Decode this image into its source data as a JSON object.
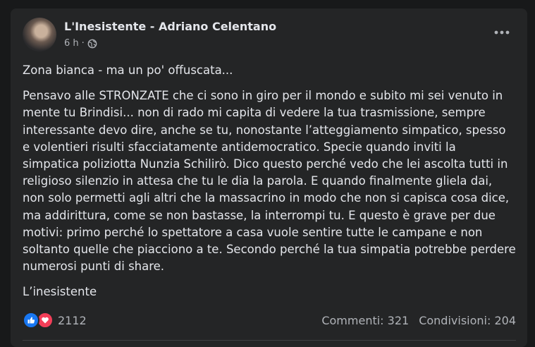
{
  "post": {
    "author": "L'Inesistente - Adriano Celentano",
    "time": "6 h",
    "separator": "·",
    "title": "Zona bianca - ma un po' offuscata...",
    "body": "Pensavo alle STRONZATE che ci sono in giro per il mondo e subito mi sei venuto in mente tu Brindisi... non di rado mi capita di vedere la tua trasmissione, sempre interessante devo dire, anche se tu, nonostante l’atteggiamento simpatico, spesso e volentieri risulti sfacciatamente antidemocratico. Specie quando inviti la simpatica poliziotta Nunzia Schilirò. Dico questo perché vedo che lei ascolta tutti in religioso silenzio in attesa che tu le dia la parola. E quando finalmente gliela dai, non solo permetti agli altri che la massacrino in modo che non si capisca cosa dice, ma addirittura, come se non bastasse, la interrompi tu. E questo è grave per due motivi: primo perché lo spettatore a casa vuole sentire tutte le campane e non soltanto quelle che piacciono a te. Secondo perché la tua simpatia potrebbe perdere numerosi punti di share.",
    "signature": "L’inesistente"
  },
  "footer": {
    "reaction_count": "2112",
    "comments": "Commenti: 321",
    "shares": "Condivisioni: 204"
  },
  "icons": {
    "privacy": "globe-icon",
    "more": "more-horizontal-icon",
    "like": "like-reaction-icon",
    "love": "love-reaction-icon"
  },
  "colors": {
    "background": "#18191a",
    "card": "#242526",
    "text_primary": "#e4e6eb",
    "text_secondary": "#b0b3b8",
    "like_blue": "#1877f2",
    "love_red": "#f33e58"
  }
}
